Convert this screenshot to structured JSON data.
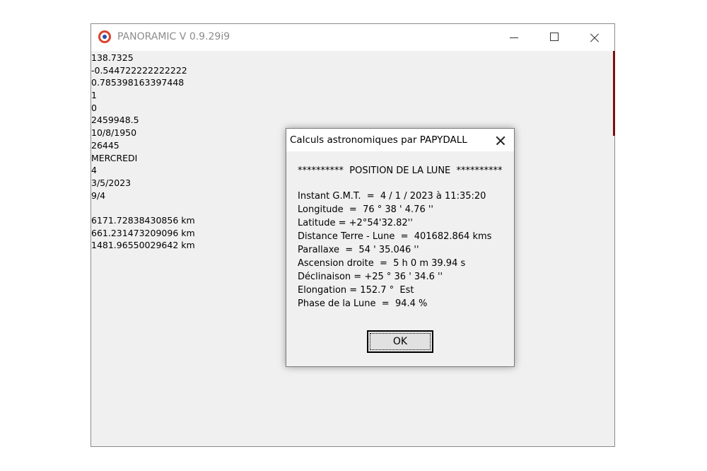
{
  "window": {
    "title": "PANORAMIC V 0.9.29i9",
    "icon": "panoramic-app-icon"
  },
  "output_lines": [
    "138.7325",
    "-0.544722222222222",
    "0.785398163397448",
    "1",
    "0",
    "2459948.5",
    "10/8/1950",
    "26445",
    "MERCREDI",
    "4",
    "3/5/2023",
    "9/4",
    "",
    "6171.72838430856 km",
    "661.231473209096 km",
    "1481.96550029642 km"
  ],
  "dialog": {
    "title": "Calculs astronomiques par PAPYDALL",
    "header": "**********  POSITION DE LA LUNE  **********",
    "lines": [
      "Instant G.M.T.  =  4 / 1 / 2023 à 11:35:20",
      "Longitude  =  76 ° 38 ' 4.76 ''",
      "Latitude = +2°54'32.82''",
      "Distance Terre - Lune  =  401682.864 kms",
      "Parallaxe  =  54 ' 35.046 ''",
      "Ascension droite  =  5 h 0 m 39.94 s",
      "Déclinaison = +25 ° 36 ' 34.6 ''",
      "Elongation = 152.7 °  Est",
      "Phase de la Lune  =  94.4 %"
    ],
    "ok_label": "OK"
  },
  "colors": {
    "window_bg": "#f0f0f0",
    "title_text": "#8c8c8c",
    "accent_mark": "#7a0f0f"
  }
}
